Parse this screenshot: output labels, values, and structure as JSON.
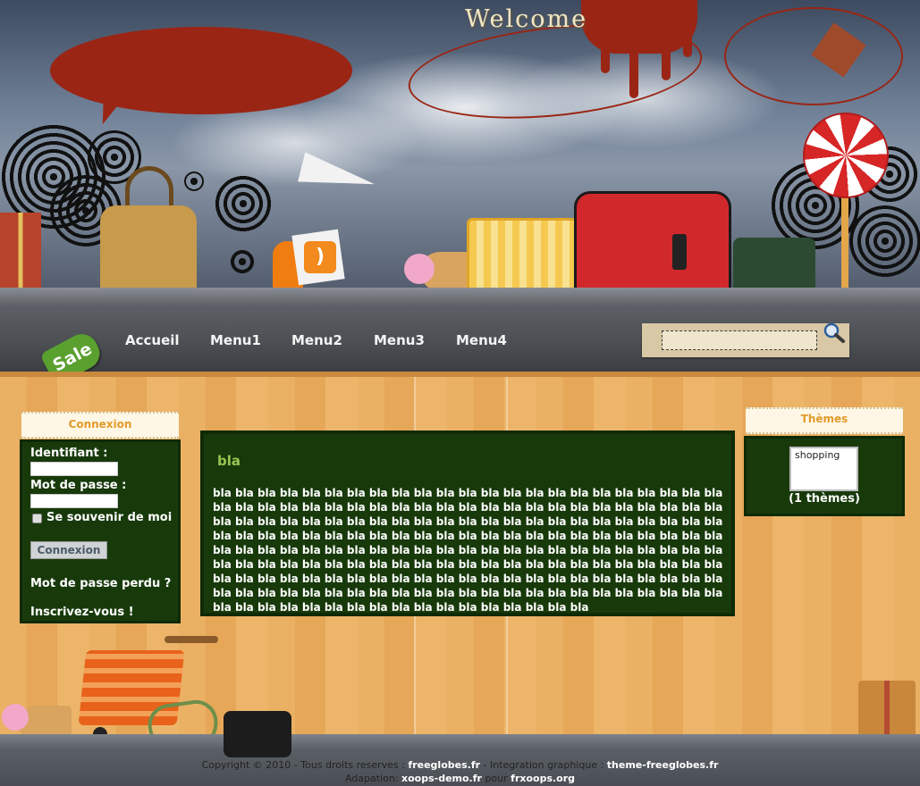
{
  "header": {
    "welcome": "Welcome"
  },
  "nav": {
    "sale_badge": "Sale",
    "items": [
      {
        "label": "Accueil"
      },
      {
        "label": "Menu1"
      },
      {
        "label": "Menu2"
      },
      {
        "label": "Menu3"
      },
      {
        "label": "Menu4"
      }
    ],
    "search": {
      "value": "",
      "icon": "search-icon"
    }
  },
  "login_block": {
    "title": "Connexion",
    "username_label": "Identifiant :",
    "password_label": "Mot de passe :",
    "remember_label": "Se souvenir de moi",
    "submit_label": "Connexion",
    "lost_password": "Mot de passe perdu ?",
    "register": "Inscrivez-vous !"
  },
  "content": {
    "title": "bla",
    "body": "bla bla bla bla bla bla bla bla bla bla bla bla bla bla bla bla bla bla bla bla bla bla bla bla bla bla bla bla bla bla bla bla bla bla bla bla bla bla bla bla bla bla bla bla bla bla bla bla bla bla bla bla bla bla bla bla bla bla bla bla bla bla bla bla bla bla bla bla bla bla bla bla bla bla bla bla bla bla bla bla bla bla bla bla bla bla bla bla bla bla bla bla bla bla bla bla bla bla bla bla bla bla bla bla bla bla bla bla bla bla bla bla bla bla bla bla bla bla bla bla bla bla bla bla bla bla bla bla bla bla bla bla bla bla bla bla bla bla bla bla bla bla bla bla bla bla bla bla bla bla bla bla bla bla bla bla bla bla bla bla bla bla bla bla bla bla bla bla bla bla bla bla bla bla bla bla bla bla bla bla bla bla bla bla bla bla bla bla bla bla bla bla bla bla bla bla bla bla bla bla bla"
  },
  "themes_block": {
    "title": "Thèmes",
    "selected": "shopping",
    "count": "(1 thèmes)"
  },
  "footer": {
    "line1_prefix": "Copyright © 2010 - Tous droits reserves : ",
    "line1_link1": "freeglobes.fr",
    "line1_mid": " - Integration graphique : ",
    "line1_link2": "theme-freeglobes.fr",
    "line2_prefix": "Adapation: ",
    "line2_link1": "xoops-demo.fr",
    "line2_mid": " pour ",
    "line2_link2": "frxoops.org"
  },
  "colors": {
    "panel_green": "#183a0b",
    "title_orange": "#e29b2a",
    "content_title_green": "#98c752",
    "wood": "#e9a94f"
  }
}
